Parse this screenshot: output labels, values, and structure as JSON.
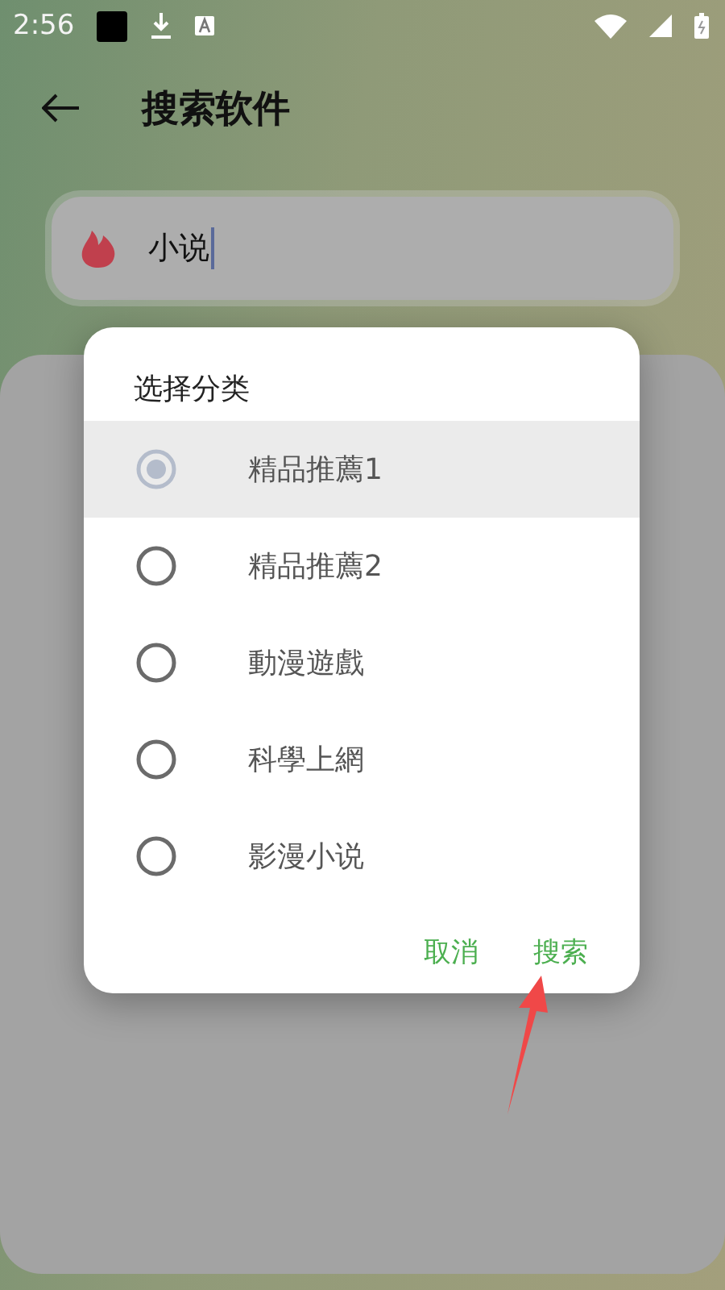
{
  "status_bar": {
    "time": "2:56"
  },
  "header": {
    "title": "搜索软件"
  },
  "search": {
    "value": "小说"
  },
  "dialog": {
    "title": "选择分类",
    "options": [
      {
        "label": "精品推薦1",
        "selected": true
      },
      {
        "label": "精品推薦2",
        "selected": false
      },
      {
        "label": "動漫遊戲",
        "selected": false
      },
      {
        "label": "科學上網",
        "selected": false
      },
      {
        "label": "影漫小说",
        "selected": false
      }
    ],
    "buttons": [
      "取消",
      "搜索"
    ]
  }
}
